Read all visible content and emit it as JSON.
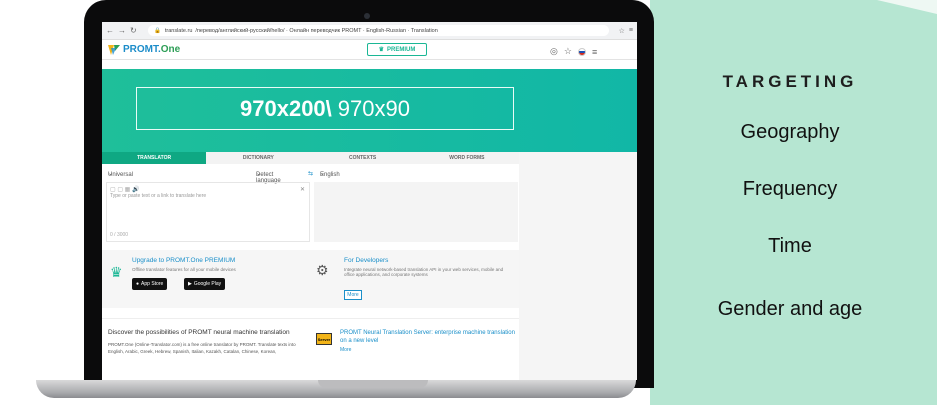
{
  "targeting": {
    "title": "TARGETING",
    "items": [
      "Geography",
      "Frequency",
      "Time",
      "Gender and age"
    ]
  },
  "browser": {
    "url_host": "translate.ru",
    "url_path": "/перевод/английский-русский/hello/ · Онлайн переводчик PROMT · English-Russian · Translation",
    "toolbar_icons": [
      "back-icon",
      "forward-icon",
      "reload-icon",
      "lock-icon",
      "star-icon",
      "menu-icon"
    ]
  },
  "app": {
    "logo": "PROMT.",
    "logo_accent": "One",
    "premium_label": "PREMIUM"
  },
  "banner": {
    "size_primary": "970x200\\",
    "size_secondary": "970x90"
  },
  "tabs": [
    "TRANSLATOR",
    "DICTIONARY",
    "CONTEXTS",
    "WORD FORMS"
  ],
  "translator": {
    "source_topic": "Universal",
    "source_lang": "Detect language",
    "target_lang": "English",
    "input_placeholder": "Type or paste text or a link to translate here",
    "counter": "0 / 3000"
  },
  "promo": {
    "upgrade_title": "Upgrade to PROMT.One PREMIUM",
    "upgrade_text": "Offline translator features for all your mobile devices",
    "app_store": "App Store",
    "google_play": "Google Play",
    "dev_title": "For Developers",
    "dev_text": "Integrate neural network-based translation API in your web services, mobile and office applications, and corporate systems",
    "more_label": "More"
  },
  "bottom": {
    "discover_title": "Discover the possibilities of PROMT neural machine translation",
    "discover_text": "PROMT.One (Online-Translator.com) is a free online translator by PROMT. Translate texts into English, Arabic, Greek, Hebrew, Spanish, Italian, Kazakh, Catalan, Chinese, Korean,",
    "server_title": "PROMT Neural Translation Server: enterprise machine translation on a new level",
    "server_badge": "Server",
    "more_label": "More"
  },
  "colors": {
    "panel": "#b6e6d2",
    "banner": "#1fbf9a",
    "accent": "#0fa883",
    "link": "#1a8fc9"
  }
}
